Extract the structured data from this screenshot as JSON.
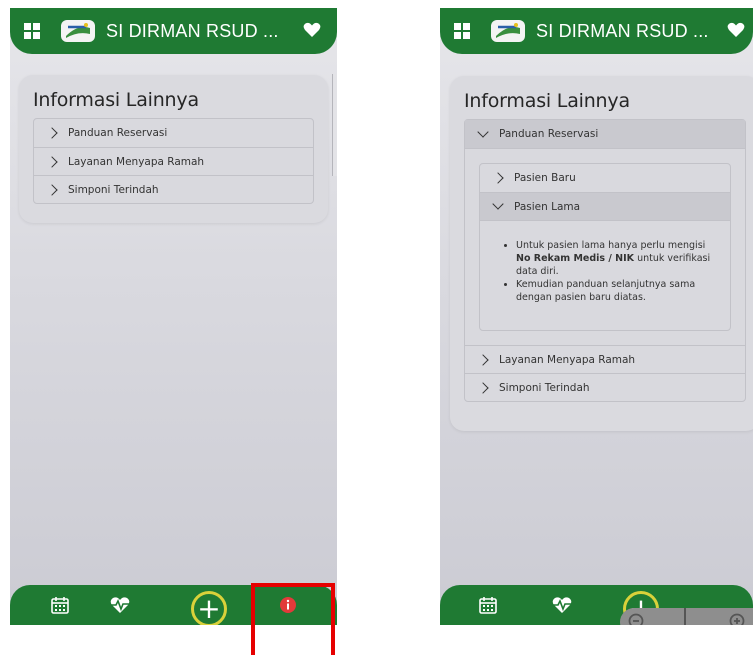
{
  "app": {
    "title": "SI DIRMAN RSUD ...",
    "brand_color": "#1f7a33",
    "fab_ring_color": "#d9d13a"
  },
  "left_screen": {
    "heading": "Informasi Lainnya",
    "items": [
      {
        "label": "Panduan Reservasi"
      },
      {
        "label": "Layanan Menyapa Ramah"
      },
      {
        "label": "Simponi Terindah"
      }
    ]
  },
  "right_screen": {
    "heading": "Informasi Lainnya",
    "open_item": "Panduan Reservasi",
    "sub_items": [
      {
        "label": "Pasien Baru"
      },
      {
        "label": "Pasien Lama"
      }
    ],
    "pasien_lama_content": {
      "bullet1_pre": "Untuk pasien lama hanya perlu mengisi",
      "bullet1_bold": "No Rekam Medis / NIK",
      "bullet1_post": "untuk verifikasi data diri.",
      "bullet2": "Kemudian panduan selanjutnya sama dengan pasien baru diatas."
    },
    "other_items": [
      {
        "label": "Layanan Menyapa Ramah"
      },
      {
        "label": "Simponi Terindah"
      }
    ]
  },
  "bottom_nav": {
    "fab_symbol": "+",
    "icons": [
      "calendar-icon",
      "heartbeat-icon",
      "add-icon",
      "info-icon"
    ]
  },
  "highlight_color": "#e60000"
}
